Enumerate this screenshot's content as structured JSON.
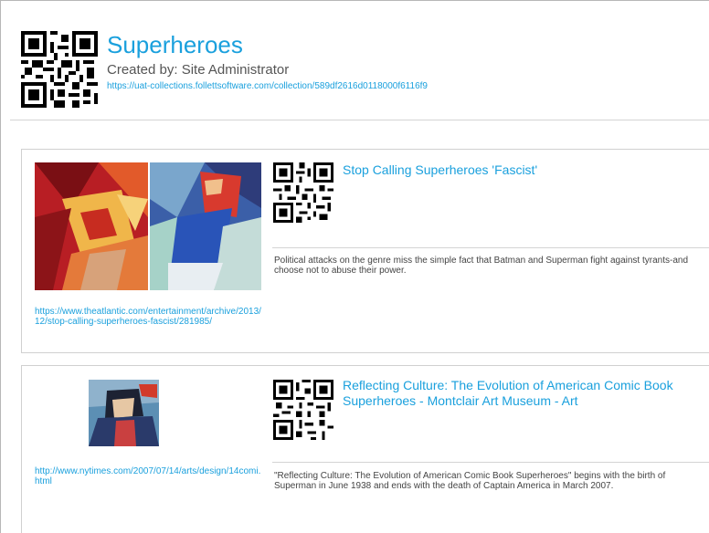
{
  "collection": {
    "title": "Superheroes",
    "creator": "Created by: Site Administrator",
    "url": "https://uat-collections.follettsoftware.com/collection/589df2616d0118000f6116f9"
  },
  "items": [
    {
      "title": "Stop Calling Superheroes 'Fascist'",
      "url": "https://www.theatlantic.com/entertainment/archive/2013/12/stop-calling-superheroes-fascist/281985/",
      "description": "Political attacks on the genre miss the simple fact that Batman and Superman fight against tyrants-and choose not to abuse their power."
    },
    {
      "title": "Reflecting Culture: The Evolution of American Comic Book Superheroes - Montclair Art Museum - Art",
      "url": "http://www.nytimes.com/2007/07/14/arts/design/14comi.html",
      "description": "\"Reflecting Culture: The Evolution of American Comic Book Superheroes\" begins with the birth of Superman in June 1938 and ends with the death of Captain America in March 2007."
    }
  ],
  "colors": {
    "link": "#1aa0dd",
    "text": "#555555"
  },
  "icons": {
    "collection_qr": "qr-code-icon",
    "item_qr": "qr-code-icon"
  }
}
